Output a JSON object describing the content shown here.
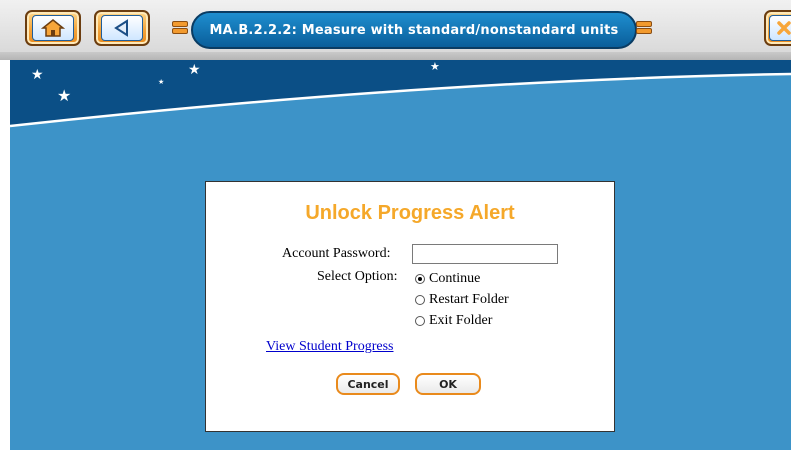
{
  "header": {
    "title": "MA.B.2.2.2: Measure with standard/nonstandard units",
    "home_icon": "home-icon",
    "back_icon": "back-triangle-icon",
    "close_icon": "close-icon"
  },
  "dialog": {
    "title": "Unlock Progress Alert",
    "password_label": "Account Password:",
    "password_value": "",
    "option_label": "Select Option:",
    "options": [
      {
        "label": "Continue",
        "selected": true
      },
      {
        "label": "Restart Folder",
        "selected": false
      },
      {
        "label": "Exit Folder",
        "selected": false
      }
    ],
    "link": "View Student Progress",
    "cancel_label": "Cancel",
    "ok_label": "OK"
  },
  "colors": {
    "accent_orange": "#f5a82a",
    "stage_blue": "#3d93c8",
    "night_blue": "#0b4f86",
    "title_pill": "#0f6fb0",
    "link_blue": "#0000cc"
  }
}
